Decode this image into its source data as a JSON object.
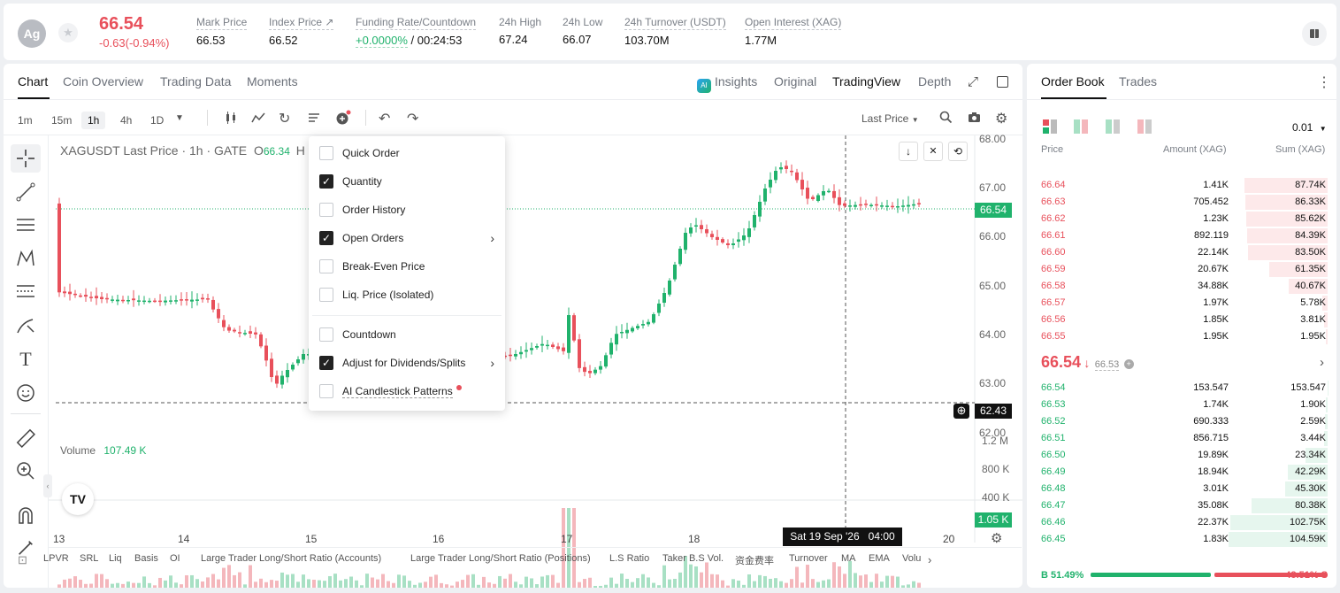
{
  "ticker": {
    "avatar": "Ag",
    "last_price": "66.54",
    "change": "-0.63(-0.94%)",
    "stats": [
      {
        "label": "Mark Price",
        "value": "66.53"
      },
      {
        "label": "Index Price ↗",
        "value": "66.52"
      },
      {
        "label": "Funding Rate/Countdown",
        "value_green": "+0.0000%",
        "value": " / 00:24:53"
      },
      {
        "label": "24h High",
        "value": "67.24"
      },
      {
        "label": "24h Low",
        "value": "66.07"
      },
      {
        "label": "24h Turnover (USDT)",
        "value": "103.70M"
      },
      {
        "label": "Open Interest (XAG)",
        "value": "1.77M"
      }
    ]
  },
  "chart_tabs": [
    "Chart",
    "Coin Overview",
    "Trading Data",
    "Moments"
  ],
  "view_tabs": {
    "insights": "Insights",
    "original": "Original",
    "tradingview": "TradingView",
    "depth": "Depth"
  },
  "intervals": [
    "1m",
    "15m",
    "1h",
    "4h",
    "1D"
  ],
  "price_type": "Last Price",
  "chart_header": {
    "title": "XAGUSDT Last Price · 1h · GATE",
    "o_label": "O",
    "o_value": "66.34",
    "h_label": "H"
  },
  "volume": {
    "label": "Volume",
    "value": "107.49 K"
  },
  "price_badges": {
    "current": "66.54",
    "cross": "62.43",
    "volume": "1.05 K"
  },
  "y_axis": [
    "68.00",
    "67.00",
    "66.00",
    "65.00",
    "64.00",
    "63.00",
    "62.00"
  ],
  "vol_axis": [
    "1.2 M",
    "800 K",
    "400 K"
  ],
  "x_axis": [
    "13",
    "14",
    "15",
    "16",
    "17",
    "18",
    "20"
  ],
  "crosshair_time": "Sat 19 Sep '26   04:00",
  "bottom_indicators": [
    "LPVR",
    "SRL",
    "Liq",
    "Basis",
    "OI",
    "Large Trader Long/Short Ratio (Accounts)",
    "Large Trader Long/Short Ratio (Positions)",
    "L.S Ratio",
    "Taker B.S Vol.",
    "资金费率",
    "Turnover",
    "MA",
    "EMA",
    "Volu"
  ],
  "menu": [
    {
      "label": "Quick Order",
      "checked": false
    },
    {
      "label": "Quantity",
      "checked": true
    },
    {
      "label": "Order History",
      "checked": false
    },
    {
      "label": "Open Orders",
      "checked": true,
      "submenu": true
    },
    {
      "label": "Break-Even Price",
      "checked": false
    },
    {
      "label": "Liq. Price (Isolated)",
      "checked": false
    },
    {
      "label": "Countdown",
      "checked": false
    },
    {
      "label": "Adjust for Dividends/Splits",
      "checked": true,
      "submenu": true
    },
    {
      "label": "AI Candlestick Patterns",
      "checked": false
    }
  ],
  "orderbook": {
    "tabs": [
      "Order Book",
      "Trades"
    ],
    "precision": "0.01",
    "headers": [
      "Price",
      "Amount (XAG)",
      "Sum (XAG)"
    ],
    "asks": [
      {
        "price": "66.64",
        "amount": "1.41K",
        "sum": "87.74K",
        "depth": 0.84
      },
      {
        "price": "66.63",
        "amount": "705.452",
        "sum": "86.33K",
        "depth": 0.83
      },
      {
        "price": "66.62",
        "amount": "1.23K",
        "sum": "85.62K",
        "depth": 0.82
      },
      {
        "price": "66.61",
        "amount": "892.119",
        "sum": "84.39K",
        "depth": 0.81
      },
      {
        "price": "66.60",
        "amount": "22.14K",
        "sum": "83.50K",
        "depth": 0.8
      },
      {
        "price": "66.59",
        "amount": "20.67K",
        "sum": "61.35K",
        "depth": 0.59
      },
      {
        "price": "66.58",
        "amount": "34.88K",
        "sum": "40.67K",
        "depth": 0.39
      },
      {
        "price": "66.57",
        "amount": "1.97K",
        "sum": "5.78K",
        "depth": 0.055
      },
      {
        "price": "66.56",
        "amount": "1.85K",
        "sum": "3.81K",
        "depth": 0.036
      },
      {
        "price": "66.55",
        "amount": "1.95K",
        "sum": "1.95K",
        "depth": 0.019
      }
    ],
    "mid": {
      "price": "66.54",
      "arrow": "↓",
      "mark": "66.53"
    },
    "bids": [
      {
        "price": "66.54",
        "amount": "153.547",
        "sum": "153.547",
        "depth": 0.0015
      },
      {
        "price": "66.53",
        "amount": "1.74K",
        "sum": "1.90K",
        "depth": 0.018
      },
      {
        "price": "66.52",
        "amount": "690.333",
        "sum": "2.59K",
        "depth": 0.025
      },
      {
        "price": "66.51",
        "amount": "856.715",
        "sum": "3.44K",
        "depth": 0.033
      },
      {
        "price": "66.50",
        "amount": "19.89K",
        "sum": "23.34K",
        "depth": 0.22
      },
      {
        "price": "66.49",
        "amount": "18.94K",
        "sum": "42.29K",
        "depth": 0.4
      },
      {
        "price": "66.48",
        "amount": "3.01K",
        "sum": "45.30K",
        "depth": 0.43
      },
      {
        "price": "66.47",
        "amount": "35.08K",
        "sum": "80.38K",
        "depth": 0.77
      },
      {
        "price": "66.46",
        "amount": "22.37K",
        "sum": "102.75K",
        "depth": 0.98
      },
      {
        "price": "66.45",
        "amount": "1.83K",
        "sum": "104.59K",
        "depth": 1.0
      }
    ],
    "buy_ratio": "B 51.49%",
    "sell_ratio": "48.51% S",
    "buy_fraction": 0.5149
  },
  "colors": {
    "up": "#20b26c",
    "down": "#e8505b"
  }
}
